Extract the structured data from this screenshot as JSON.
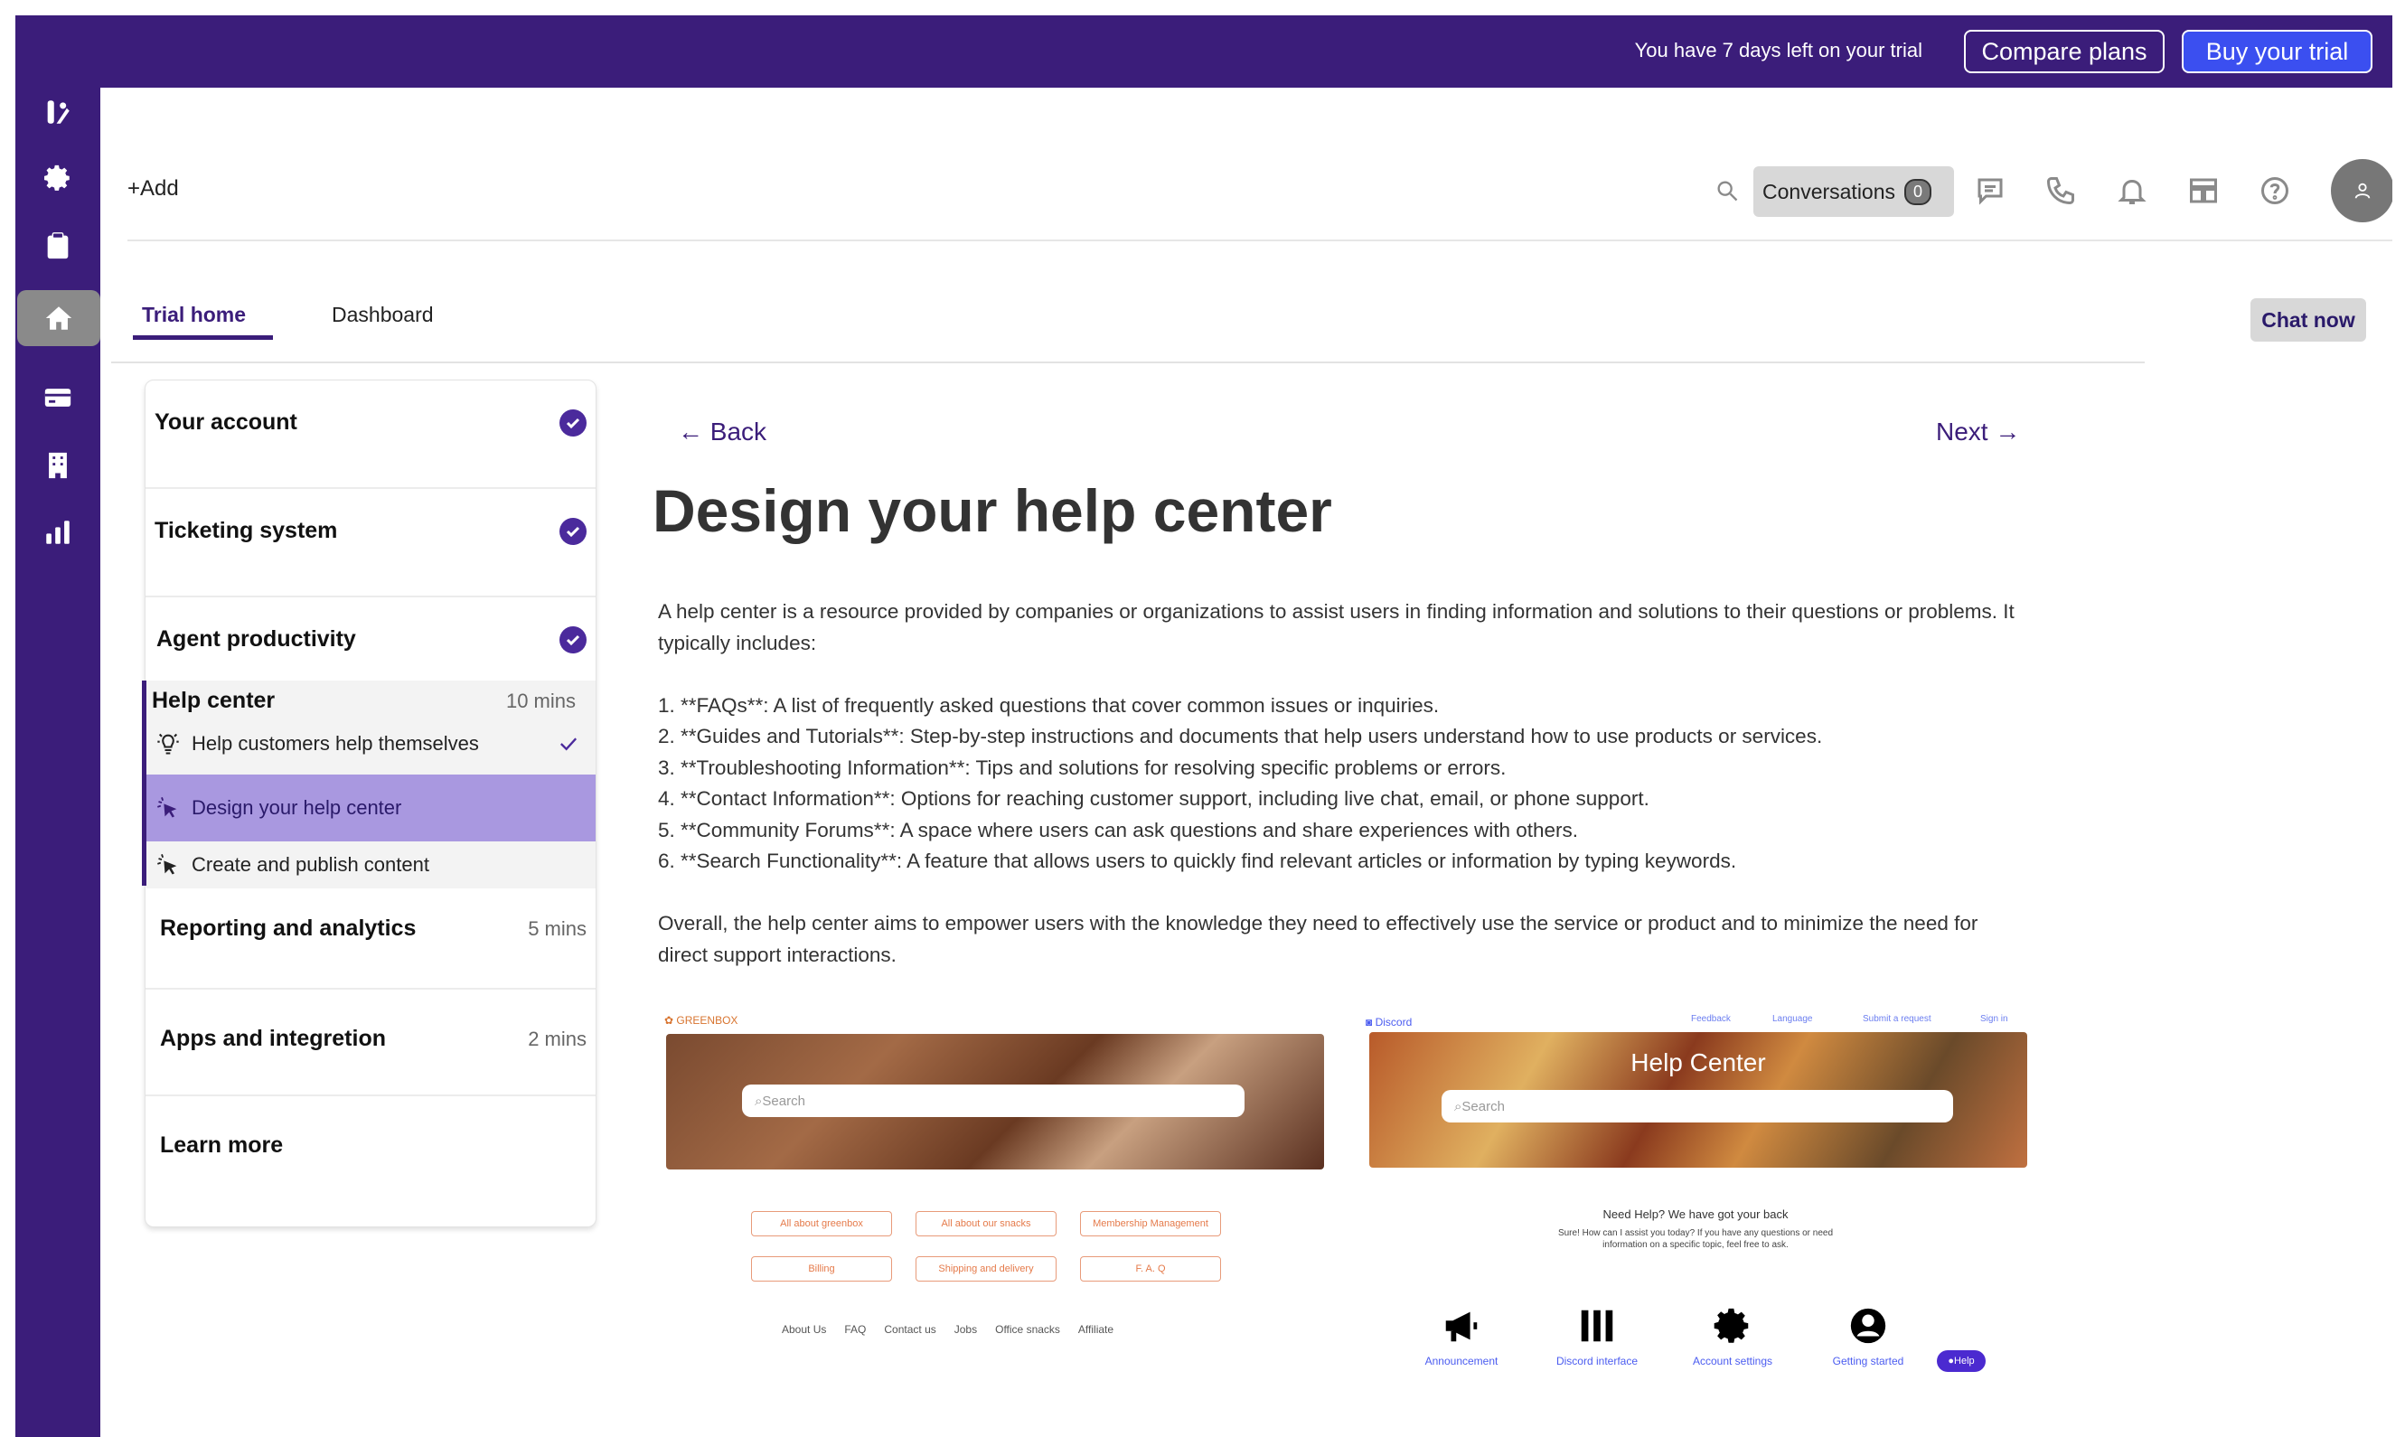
{
  "topbar": {
    "trial_text": "You have 7 days left on your trial",
    "compare_label": "Compare plans",
    "buy_label": "Buy your trial"
  },
  "leftnav": {
    "icons": [
      "logo-icon",
      "gear-icon",
      "clipboard-icon",
      "home-icon",
      "card-icon",
      "building-icon",
      "bar-chart-icon"
    ],
    "active": "home-icon"
  },
  "header": {
    "add_label": "Add",
    "conversations_label": "Conversations",
    "conversations_count": "0"
  },
  "tabs": {
    "trial_home": "Trial home",
    "dashboard": "Dashboard"
  },
  "chat_now": "Chat now",
  "sidebar": {
    "your_account": "Your account",
    "ticketing_system": "Ticketing system",
    "agent_productivity": "Agent productivity",
    "help_center": "Help center",
    "help_center_mins": "10 mins",
    "sub_help_customers": "Help customers help themselves",
    "sub_design": "Design your help center",
    "sub_create": "Create and publish content",
    "reporting": "Reporting and analytics",
    "reporting_mins": "5 mins",
    "apps": "Apps and integretion",
    "apps_mins": "2 mins",
    "learn_more": "Learn more"
  },
  "content": {
    "back": "← Back",
    "next": "Next →",
    "title": "Design your help center",
    "intro": "A help center is a resource provided by companies or organizations to assist users in finding information and solutions to their questions or problems. It typically includes:",
    "items": [
      "1. **FAQs**: A list of frequently asked questions that cover common issues or inquiries.",
      "2. **Guides and Tutorials**: Step-by-step instructions and documents that help users understand how to use products or services.",
      "3. **Troubleshooting Information**: Tips and solutions for resolving specific problems or errors.",
      "4. **Contact Information**: Options for reaching customer support, including live chat, email, or phone support.",
      "5. **Community Forums**: A space where users can ask questions and share experiences with others.",
      "6. **Search Functionality**: A feature that allows users to quickly find relevant articles or information by typing keywords."
    ],
    "outro": "Overall, the help center aims to empower users with the knowledge they need to effectively use the service or product and to minimize the need for direct support interactions."
  },
  "greenbox": {
    "logo": "GREENBOX",
    "search_placeholder": "Search",
    "buttons": [
      "All about greenbox",
      "All about our snacks",
      "Membership Management",
      "Billing",
      "Shipping and delivery",
      "F. A. Q"
    ],
    "footer": [
      "About Us",
      "FAQ",
      "Contact us",
      "Jobs",
      "Office snacks",
      "Affiliate"
    ]
  },
  "discord": {
    "logo": "Discord",
    "links": [
      "Feedback",
      "Language",
      "Submit a request",
      "Sign in"
    ],
    "hero_title": "Help Center",
    "search_placeholder": "Search",
    "need_help": "Need Help? We have got your back",
    "sure_line1": "Sure! How can I assist you today? If you have any questions or need",
    "sure_line2": "information on a specific topic, feel free to ask.",
    "categories": [
      "Announcement",
      "Discord interface",
      "Account settings",
      "Getting started"
    ],
    "help_badge": "Help"
  }
}
